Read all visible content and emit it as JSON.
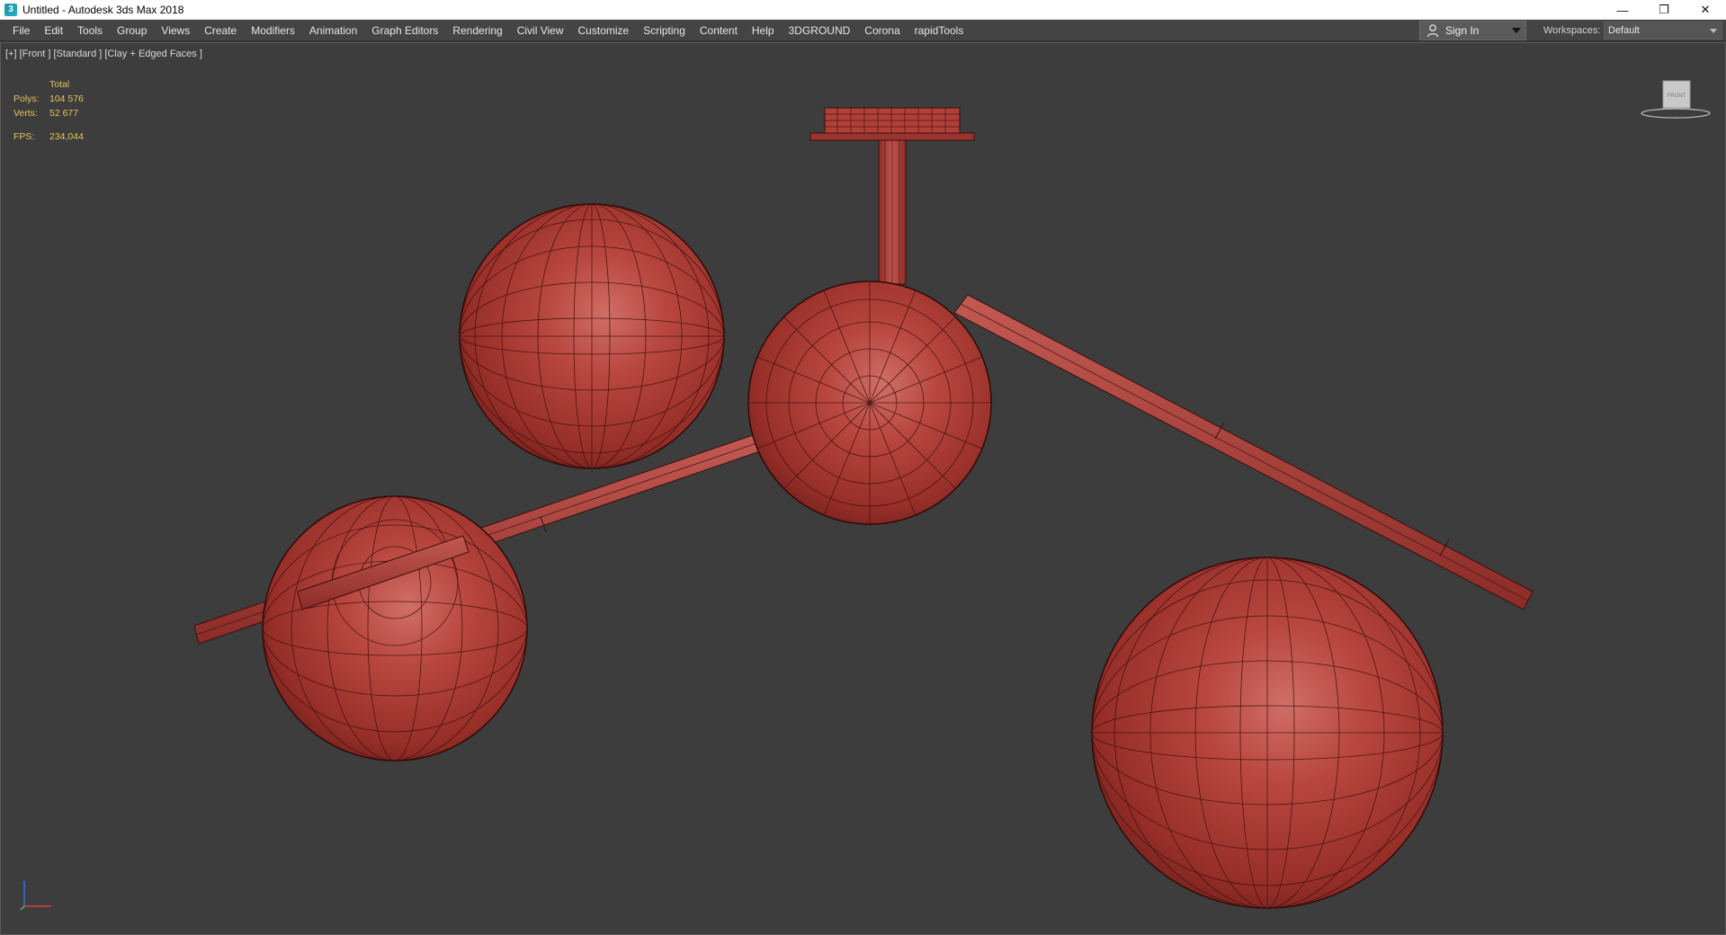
{
  "window": {
    "title": "Untitled - Autodesk 3ds Max 2018",
    "logo_icon": "3dsmax-logo-icon",
    "controls": [
      {
        "name": "minimize-button",
        "glyph": "—"
      },
      {
        "name": "restore-button",
        "glyph": "❐"
      },
      {
        "name": "close-button",
        "glyph": "✕"
      }
    ]
  },
  "menu": {
    "items": [
      "File",
      "Edit",
      "Tools",
      "Group",
      "Views",
      "Create",
      "Modifiers",
      "Animation",
      "Graph Editors",
      "Rendering",
      "Civil View",
      "Customize",
      "Scripting",
      "Content",
      "Help",
      "3DGROUND",
      "Corona",
      "rapidTools"
    ]
  },
  "account": {
    "sign_in_label": "Sign In",
    "icon": "user-icon"
  },
  "workspaces": {
    "label": "Workspaces:",
    "selected": "Default"
  },
  "viewport": {
    "label": "[+] [Front ] [Standard ] [Clay + Edged Faces ]",
    "stats": {
      "header": "Total",
      "polys_label": "Polys:",
      "polys_value": "104 576",
      "verts_label": "Verts:",
      "verts_value": "52 677",
      "fps_label": "FPS:",
      "fps_value": "234,044"
    },
    "viewcube_label": "FRONT",
    "model_color": "#b23a32"
  },
  "colors": {
    "background": "#3d3d3d",
    "menubar": "#444444",
    "stats_text": "#e7c45a"
  }
}
